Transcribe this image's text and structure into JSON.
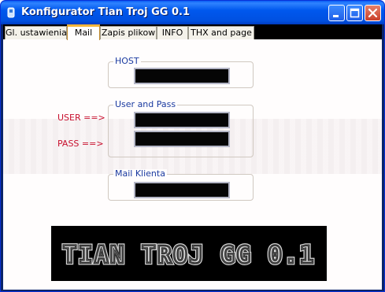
{
  "window": {
    "title": "Konfigurator Tian Troj GG 0.1"
  },
  "tabs": [
    {
      "label": "Gl. ustawienia"
    },
    {
      "label": "Mail"
    },
    {
      "label": "Zapis plikow"
    },
    {
      "label": "INFO"
    },
    {
      "label": "THX and page"
    }
  ],
  "active_tab": "Mail",
  "mail": {
    "host_group": {
      "label": "HOST",
      "value": ""
    },
    "user_pass_group": {
      "label": "User and Pass",
      "user_value": "",
      "pass_value": ""
    },
    "user_label": "USER ==>",
    "pass_label": "PASS ==>",
    "mail_group": {
      "label": "Mail Klienta",
      "value": ""
    }
  },
  "banner": {
    "text": "TIAN TROJ GG 0.1"
  },
  "colors": {
    "title_bar": "#0058ee",
    "field_bg": "#050505",
    "side_label": "#c8102e",
    "group_label": "#1a3aa0"
  },
  "icons": [
    "app-icon",
    "minimize-icon",
    "maximize-icon",
    "close-icon"
  ]
}
